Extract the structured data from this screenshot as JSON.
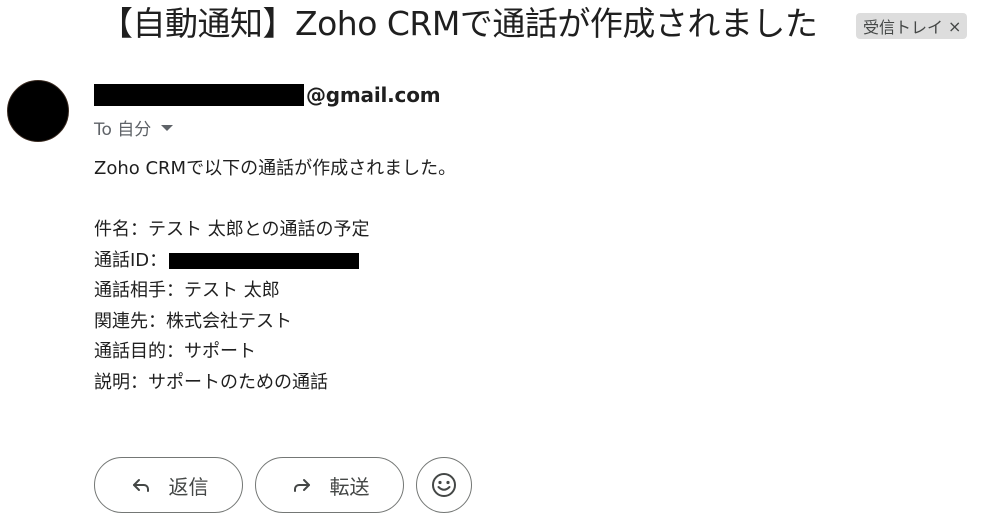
{
  "email": {
    "subject": "【自動通知】Zoho CRMで通話が作成されました",
    "label": {
      "name": "受信トレイ",
      "remove_symbol": "×"
    },
    "sender": {
      "email_domain": "@gmail.com"
    },
    "recipient": {
      "label": "To 自分"
    },
    "body": {
      "intro": "Zoho CRMで以下の通話が作成されました。",
      "subject_line": "件名：テスト 太郎との通話の予定",
      "call_id_label": "通話ID：",
      "contact_line": "通話相手：テスト 太郎",
      "related_line": "関連先：株式会社テスト",
      "purpose_line": "通話目的：サポート",
      "description_line": "説明：サポートのための通話"
    }
  },
  "actions": {
    "reply_label": "返信",
    "forward_label": "転送"
  },
  "icons": {
    "reply": "reply-arrow-icon",
    "forward": "forward-arrow-icon",
    "emoji": "smiley-face-icon",
    "dropdown": "caret-down-icon"
  },
  "colors": {
    "chip_background": "#dddddd",
    "text": "#1f1f1f",
    "secondary_text": "#5f6368",
    "button_border": "#747775"
  }
}
